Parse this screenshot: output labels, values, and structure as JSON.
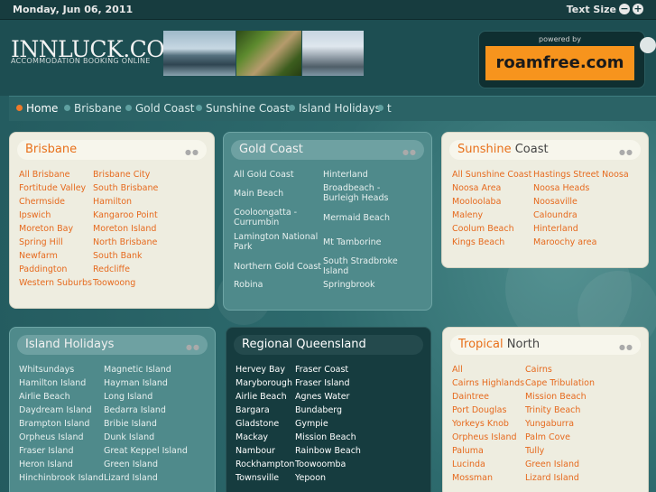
{
  "topbar": {
    "date": "Monday, Jun 06, 2011",
    "text_size_label": "Text Size",
    "minus": "−",
    "plus": "+"
  },
  "header": {
    "logo": "INNLUCK.COM",
    "tagline": "ACCOMMODATION BOOKING ONLINE",
    "ad": {
      "powered": "powered by",
      "brand": "roamfree.com"
    }
  },
  "nav": [
    "Home",
    "Brisbane",
    "Gold Coast",
    "Sunshine Coast",
    "Island Holidays",
    "t"
  ],
  "panels": {
    "brisbane": {
      "title_a": "Brisbane",
      "title_b": "",
      "links": [
        "All Brisbane",
        "Brisbane City",
        "Fortitude Valley",
        "South Brisbane",
        "Chermside",
        "Hamilton",
        "Ipswich",
        "Kangaroo Point",
        "Moreton Bay",
        "Moreton Island",
        "Spring Hill",
        "North Brisbane",
        "Newfarm",
        "South Bank",
        "Paddington",
        "Redcliffe",
        "Western Suburbs",
        "Toowoong"
      ]
    },
    "goldcoast": {
      "title_a": "Gold",
      "title_b": " Coast",
      "links": [
        "All Gold Coast",
        "Hinterland",
        "Main Beach",
        "Broadbeach - Burleigh Heads",
        "Cooloongatta - Currumbin",
        "Mermaid Beach",
        "Lamington National Park",
        "Mt Tamborine",
        "Northern Gold Coast",
        "South Stradbroke Island",
        "Robina",
        "Springbrook"
      ]
    },
    "sunshine": {
      "title_a": "Sunshine",
      "title_b": " Coast",
      "links": [
        "All Sunshine Coast",
        "Hastings Street Noosa",
        "Noosa Area",
        "Noosa Heads",
        "Mooloolaba",
        "Noosaville",
        "Maleny",
        "Caloundra",
        "Coolum Beach",
        "Hinterland",
        "Kings Beach",
        "Maroochy area"
      ]
    },
    "islands": {
      "title_a": "Island",
      "title_b": " Holidays",
      "links": [
        "Whitsundays",
        "Magnetic Island",
        "Hamilton Island",
        "Hayman Island",
        "Airlie Beach",
        "Long Island",
        "Daydream Island",
        "Bedarra Island",
        "Brampton Island",
        "Bribie Island",
        "Orpheus Island",
        "Dunk Island",
        "Fraser Island",
        "Great Keppel Island",
        "Heron Island",
        "Green Island",
        "Hinchinbrook Island",
        "Lizard Island"
      ]
    },
    "regional": {
      "title_a": "Regional",
      "title_b": " Queensland",
      "links": [
        "Hervey Bay",
        "Fraser Coast",
        "Maryborough",
        "Fraser Island",
        "Airlie Beach",
        "Agnes Water",
        "Bargara",
        "Bundaberg",
        "Gladstone",
        "Gympie",
        "Mackay",
        "Mission Beach",
        "Nambour",
        "Rainbow Beach",
        "Rockhampton",
        "Toowoomba",
        "Townsville",
        "Yepoon"
      ]
    },
    "tropical": {
      "title_a": "Tropical",
      "title_b": " North",
      "links": [
        "All",
        "Cairns",
        "Cairns Highlands",
        "Cape Tribulation",
        "Daintree",
        "Mission Beach",
        "Port Douglas",
        "Trinity Beach",
        "Yorkeys Knob",
        "Yungaburra",
        "Orpheus Island",
        "Palm Cove",
        "Paluma",
        "Tully",
        "Lucinda",
        "Green Island",
        "Mossman",
        "Lizard Island"
      ]
    }
  },
  "colors": {
    "accent": "#e66a1e",
    "background": "#245f63"
  }
}
